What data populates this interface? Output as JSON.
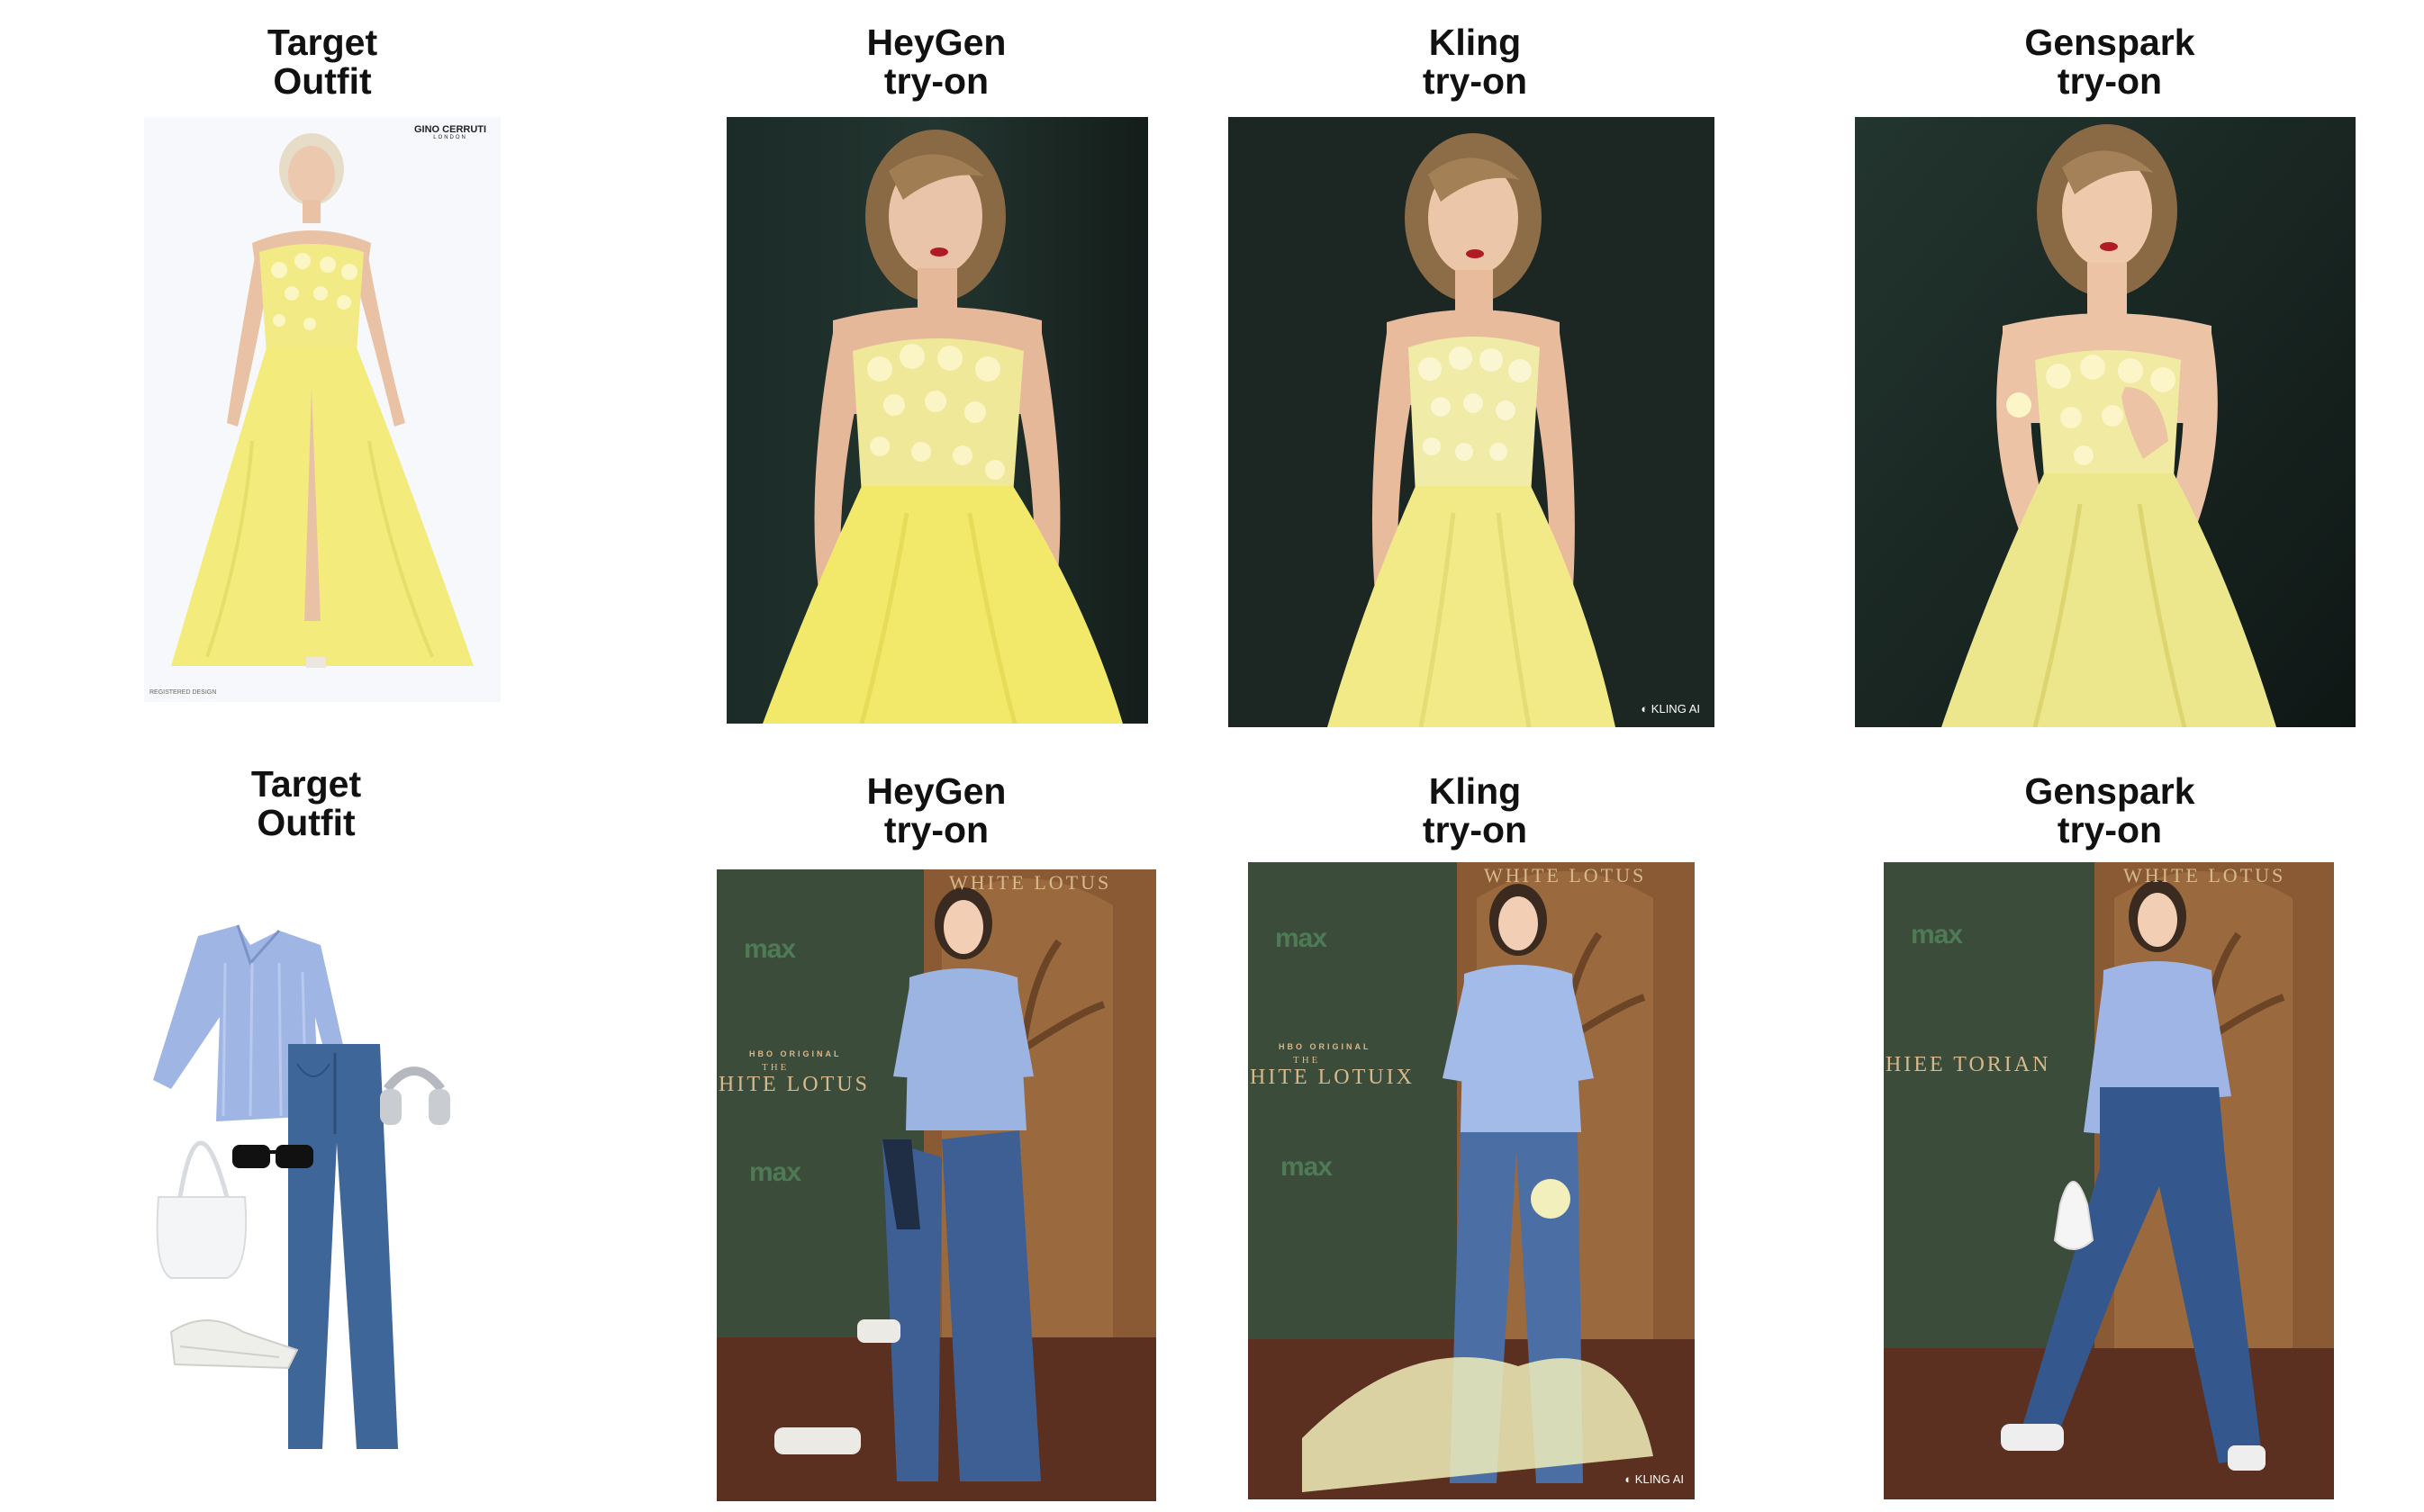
{
  "rows": [
    {
      "headers": [
        {
          "line1": "Target",
          "line2": "Outfit"
        },
        {
          "line1": "HeyGen",
          "line2": "try-on"
        },
        {
          "line1": "Kling",
          "line2": "try-on"
        },
        {
          "line1": "Genspark",
          "line2": "try-on"
        }
      ],
      "target": {
        "logo_line1": "GINO CERRUTI",
        "logo_line2": "LONDON",
        "footer": "REGISTERED DESIGN"
      },
      "kling_watermark": "KLING AI"
    },
    {
      "headers": [
        {
          "line1": "Target",
          "line2": "Outfit"
        },
        {
          "line1": "HeyGen",
          "line2": "try-on"
        },
        {
          "line1": "Kling",
          "line2": "try-on"
        },
        {
          "line1": "Genspark",
          "line2": "try-on"
        }
      ],
      "heygen": {
        "banner_top": "WHITE LOTUS",
        "logo_top": "max",
        "hbo": "HBO ORIGINAL",
        "the": "THE",
        "title": "HITE LOTUS",
        "logo_bottom": "max"
      },
      "kling": {
        "banner_top": "WHITE LOTUS",
        "logo_top": "max",
        "hbo": "HBO ORIGINAL",
        "the": "THE",
        "title": "HITE LOTUIX",
        "logo_bottom": "max",
        "watermark": "KLING AI"
      },
      "genspark": {
        "banner_top": "WHITE LOTUS",
        "logo_top": "max",
        "title": "HIEE TORIAN"
      }
    }
  ],
  "colors": {
    "dress_yellow": "#f3ec7c",
    "dark_backdrop": "#1d2622",
    "green_wall": "#3c4d3c",
    "wood_floor": "#5a3020",
    "shirt_blue": "#9bb3e3",
    "denim": "#3e5f93"
  }
}
